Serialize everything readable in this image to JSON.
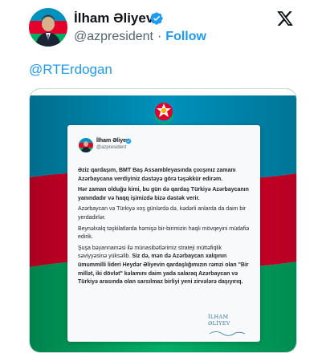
{
  "author": {
    "name": "İlham Əliyev",
    "handle": "@azpresident",
    "separator": "·",
    "follow_label": "Follow"
  },
  "tweet": {
    "mention": "@RTErdogan"
  },
  "image_card": {
    "author_name": "İlham Əliyev",
    "author_handle": "@azpresident",
    "paragraph_1_bold": "Əziz qardaşım, BMT Baş Assambleyasında çıxışınız zamanı Azərbaycana verdiyiniz dəstəyə görə təşəkkür edirəm.",
    "paragraph_2_bold": "Hər zaman olduğu kimi, bu gün də qardaş Türkiyə Azərbaycanın yanındadır və haqq işimizdə bizə dəstək verir.",
    "paragraph_3": "Azərbaycan və Türkiyə xoş günlərdə də, kədərli anlarda da daim bir yerdadirlər.",
    "paragraph_4": "Beynəlxalq təşkilatlarda həmişə bir-birimizin haqlı mövqeyini müdafiə edirik.",
    "paragraph_5_normal": "Şuşa bəyannaməsi ilə münasibətlərimiz strateji müttəfiqlik səviyyəsinə yüksəlib.",
    "paragraph_5_bold": " Siz də, mən də Azərbaycan xalqının ümummilli lideri Heydər Əliyevin qardaşlığımızın rəmzi olan \"Bir millət, iki dövlət\" kəlamını daim yada salaraq Azərbaycan və Türkiyə arasında olan sarsılmaz birliyi yeni zirvələrə daşıyırıq.",
    "signature": "İLHAM ƏLİYEV"
  },
  "colors": {
    "flag_blue": "#0092bc",
    "flag_red": "#e4002b",
    "flag_green": "#00af66",
    "link_blue": "#1d9bf0",
    "verified_blue": "#1d9bf0"
  }
}
